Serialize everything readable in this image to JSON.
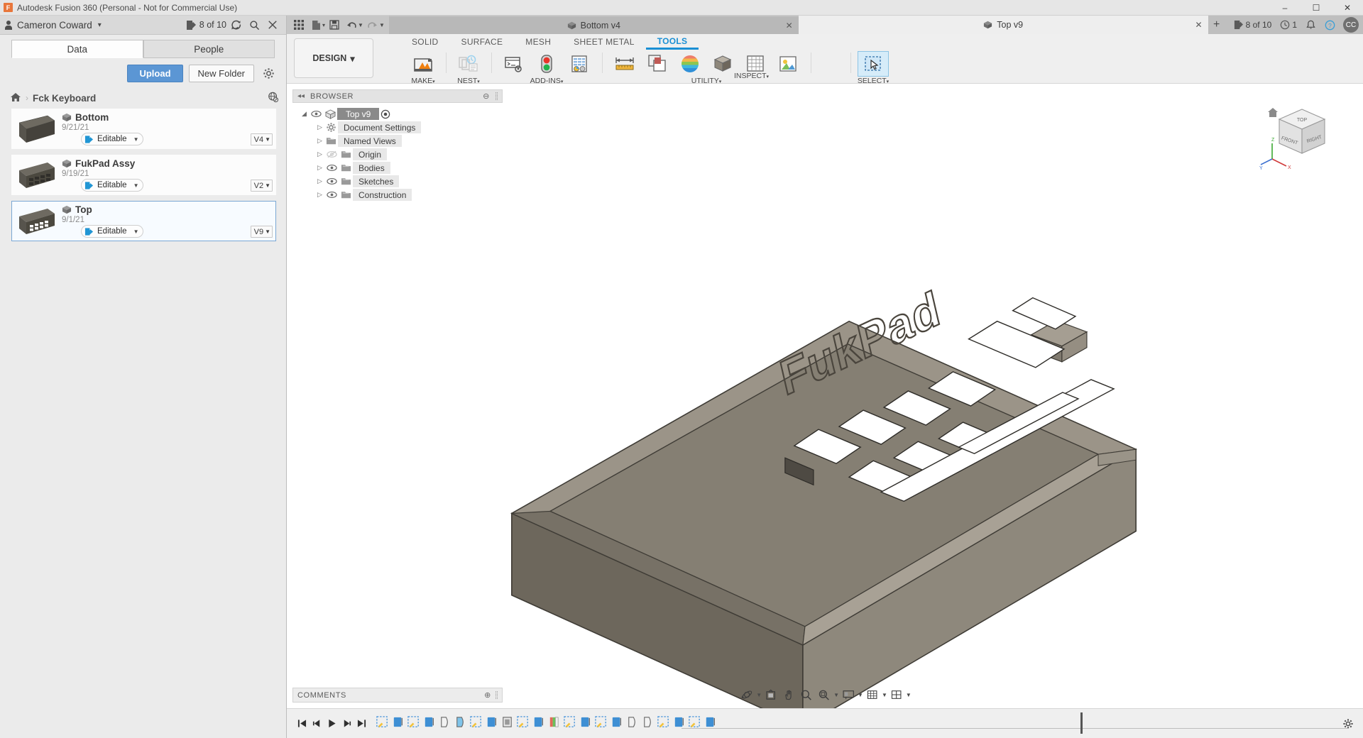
{
  "window": {
    "title": "Autodesk Fusion 360 (Personal - Not for Commercial Use)",
    "logo_text": "F",
    "minimize": "–",
    "maximize": "☐",
    "close": "✕"
  },
  "data_panel": {
    "account": {
      "user_name": "Cameron Coward",
      "caret": "▾",
      "editable_count": "8 of 10",
      "refresh_icon": "refresh-icon",
      "search_icon": "search-icon",
      "close_icon": "close-icon"
    },
    "tabs": [
      {
        "label": "Data",
        "active": true
      },
      {
        "label": "People",
        "active": false
      }
    ],
    "actions": {
      "upload_label": "Upload",
      "new_folder_label": "New Folder",
      "settings_icon": "gear-icon"
    },
    "breadcrumb": {
      "home_icon": "home-icon",
      "separator": "›",
      "folder": "Fck Keyboard",
      "globe_icon": "globe-icon"
    },
    "files": [
      {
        "name": "Bottom",
        "date": "9/21/21",
        "permission": "Editable",
        "version": "V4",
        "thumb": "flat-plate",
        "selected": false
      },
      {
        "name": "FukPad Assy",
        "date": "9/19/21",
        "permission": "Editable",
        "version": "V2",
        "thumb": "assembly",
        "selected": false
      },
      {
        "name": "Top",
        "date": "9/1/21",
        "permission": "Editable",
        "version": "V9",
        "thumb": "top-plate",
        "selected": true
      }
    ]
  },
  "quick_access": {
    "grid_icon": "app-grid-icon",
    "new_icon": "new-document-icon",
    "save_icon": "save-icon",
    "undo_icon": "undo-icon",
    "redo_icon": "redo-icon",
    "caret": "▾"
  },
  "document_tabs": [
    {
      "label": "Bottom v4",
      "active": false,
      "close": "✕"
    },
    {
      "label": "Top v9",
      "active": true,
      "close": "✕"
    }
  ],
  "tabstrip_right": {
    "new_tab": "+",
    "editable_count": "8 of 10",
    "job_count": "1",
    "notifications_icon": "bell-icon",
    "help_icon": "help-icon",
    "avatar_initials": "CC"
  },
  "ribbon": {
    "workspace": {
      "label": "DESIGN",
      "caret": "▾"
    },
    "tabs": [
      {
        "label": "SOLID",
        "active": false
      },
      {
        "label": "SURFACE",
        "active": false
      },
      {
        "label": "MESH",
        "active": false
      },
      {
        "label": "SHEET METAL",
        "active": false
      },
      {
        "label": "TOOLS",
        "active": true
      }
    ],
    "groups": [
      {
        "label": "MAKE",
        "caret": "▾",
        "icons": [
          "3d-print-icon"
        ]
      },
      {
        "label": "NEST",
        "caret": "▾",
        "icons": [
          "nest-arrange-icon",
          "nest-study-icon"
        ]
      },
      {
        "label": "ADD-INS",
        "caret": "▾",
        "icons": [
          "script-icon",
          "traffic-light-icon",
          "spreadsheet-icon"
        ]
      },
      {
        "label": "UTILITY",
        "caret": "▾",
        "icons": [
          "measure-icon",
          "section-icon",
          "appearance-icon",
          "material-icon",
          "drawing-icon",
          "render-icon"
        ]
      },
      {
        "label": "INSPECT",
        "caret": "▾",
        "icons": []
      },
      {
        "label": "SELECT",
        "caret": "▾",
        "icons": [
          "select-window-icon"
        ]
      }
    ]
  },
  "browser": {
    "header": {
      "collapse_icon": "◂◂",
      "title": "BROWSER",
      "settings_dot": "⊖"
    },
    "root": {
      "label": "Top v9",
      "eye": "visible",
      "target_icon": "target-icon"
    },
    "nodes": [
      {
        "label": "Document Settings",
        "icon": "gear-icon",
        "eye": null
      },
      {
        "label": "Named Views",
        "icon": "folder-icon",
        "eye": null
      },
      {
        "label": "Origin",
        "icon": "folder-icon",
        "eye": "hidden"
      },
      {
        "label": "Bodies",
        "icon": "folder-icon",
        "eye": "visible"
      },
      {
        "label": "Sketches",
        "icon": "folder-icon",
        "eye": "visible"
      },
      {
        "label": "Construction",
        "icon": "folder-icon",
        "eye": "visible"
      }
    ]
  },
  "comments": {
    "title": "COMMENTS",
    "add_icon": "⊕"
  },
  "viewcube": {
    "front": "FRONT",
    "right": "RIGHT",
    "top": "TOP",
    "axis_x": "X",
    "axis_y": "Y",
    "axis_z": "Z",
    "home_icon": "home-icon"
  },
  "nav_bar": {
    "items": [
      {
        "icon": "orbit-icon",
        "caret": "▾"
      },
      {
        "icon": "look-at-icon",
        "caret": ""
      },
      {
        "icon": "pan-icon",
        "caret": ""
      },
      {
        "icon": "zoom-icon",
        "caret": ""
      },
      {
        "icon": "fit-icon",
        "caret": "▾"
      },
      {
        "icon": "display-settings-icon",
        "caret": "▾"
      },
      {
        "icon": "grid-snap-icon",
        "caret": "▾"
      },
      {
        "icon": "viewports-icon",
        "caret": "▾"
      }
    ]
  },
  "timeline": {
    "playback": [
      "⏮",
      "◀▎",
      "▶",
      "▎▶",
      "⏭"
    ],
    "feature_count": 22,
    "settings_icon": "gear-icon"
  },
  "canvas": {
    "model_label": "FukPad",
    "background": "#ffffff",
    "body_color": "#7d776c"
  }
}
